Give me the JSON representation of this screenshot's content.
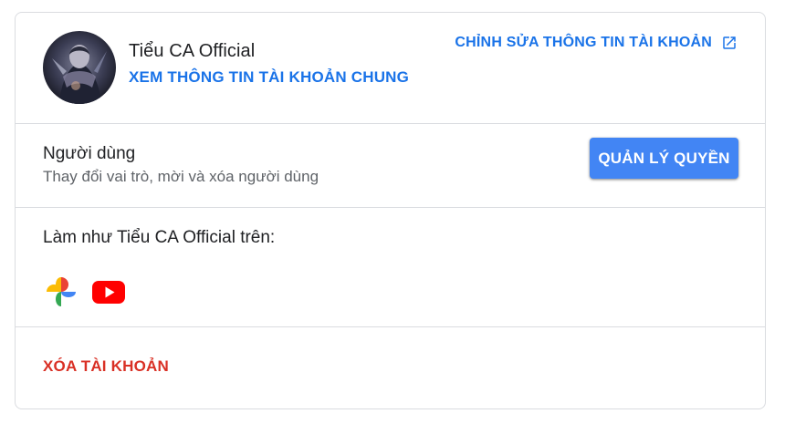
{
  "account": {
    "name": "Tiểu CA Official",
    "view_account_link": "XEM THÔNG TIN TÀI KHOẢN CHUNG",
    "edit_account_link": "CHỈNH SỬA THÔNG TIN TÀI KHOẢN",
    "edit_link_icon": "open-in-new-icon"
  },
  "users": {
    "title": "Người dùng",
    "description": "Thay đổi vai trò, mời và xóa người dùng",
    "manage_button": "QUẢN LÝ QUYỀN"
  },
  "act_as": {
    "title": "Làm như Tiểu CA Official trên:",
    "apps": [
      {
        "name": "Google Photos",
        "icon": "google-photos-icon"
      },
      {
        "name": "YouTube",
        "icon": "youtube-icon"
      }
    ]
  },
  "delete": {
    "label": "XÓA TÀI KHOẢN"
  },
  "colors": {
    "link_blue": "#1a73e8",
    "button_blue": "#4285f4",
    "danger_red": "#d93025",
    "divider": "#dadce0"
  }
}
